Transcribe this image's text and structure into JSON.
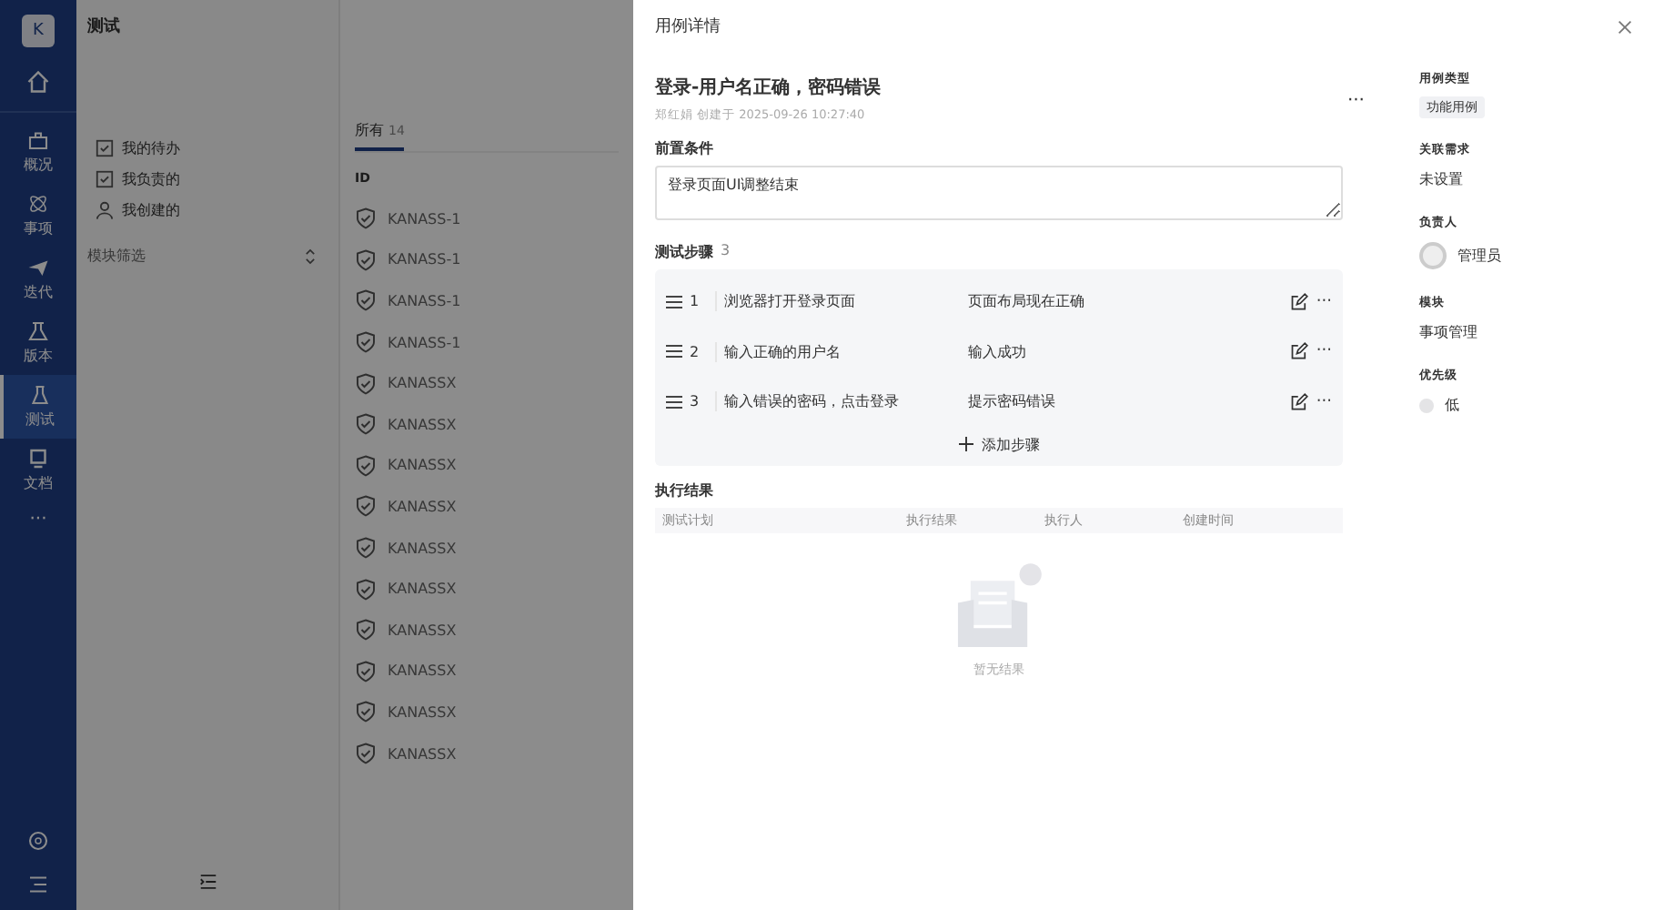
{
  "nav": {
    "logo": "K",
    "items": [
      {
        "label": "概况",
        "selected": false
      },
      {
        "label": "事项",
        "selected": false
      },
      {
        "label": "迭代",
        "selected": false
      },
      {
        "label": "版本",
        "selected": false
      },
      {
        "label": "测试",
        "selected": true
      },
      {
        "label": "文档",
        "selected": false
      }
    ],
    "more": "···"
  },
  "page": {
    "title": "测试",
    "filters": [
      {
        "label": "我的待办"
      },
      {
        "label": "我负责的"
      },
      {
        "label": "我创建的"
      }
    ],
    "module_filter": "模块筛选"
  },
  "list": {
    "tabs": [
      {
        "label": "所有",
        "count": "14",
        "selected": true
      }
    ],
    "column": "ID",
    "rows": [
      "KANASS-1",
      "KANASS-1",
      "KANASS-1",
      "KANASS-1",
      "KANASSX",
      "KANASSX",
      "KANASSX",
      "KANASSX",
      "KANASSX",
      "KANASSX",
      "KANASSX",
      "KANASSX",
      "KANASSX",
      "KANASSX"
    ]
  },
  "drawer": {
    "header": "用例详情",
    "title": "登录-用户名正确，密码错误",
    "more": "···",
    "meta": "郑红娟 创建于 2025-09-26 10:27:40",
    "precondition": {
      "label": "前置条件",
      "value": "登录页面UI调整结束"
    },
    "steps": {
      "label": "测试步骤",
      "count": "3",
      "add": "添加步骤",
      "items": [
        {
          "no": "1",
          "action": "浏览器打开登录页面",
          "expected": "页面布局现在正确"
        },
        {
          "no": "2",
          "action": "输入正确的用户名",
          "expected": "输入成功"
        },
        {
          "no": "3",
          "action": "输入错误的密码，点击登录",
          "expected": "提示密码错误"
        }
      ]
    },
    "results": {
      "label": "执行结果",
      "columns": [
        "测试计划",
        "执行结果",
        "执行人",
        "创建时间"
      ],
      "empty": "暂无结果"
    },
    "fields": [
      {
        "label": "用例类型",
        "kind": "tag",
        "value": "功能用例"
      },
      {
        "label": "关联需求",
        "kind": "text",
        "value": "未设置"
      },
      {
        "label": "负责人",
        "kind": "user",
        "value": "管理员"
      },
      {
        "label": "模块",
        "kind": "text",
        "value": "事项管理"
      },
      {
        "label": "优先级",
        "kind": "priority",
        "value": "低"
      }
    ]
  }
}
